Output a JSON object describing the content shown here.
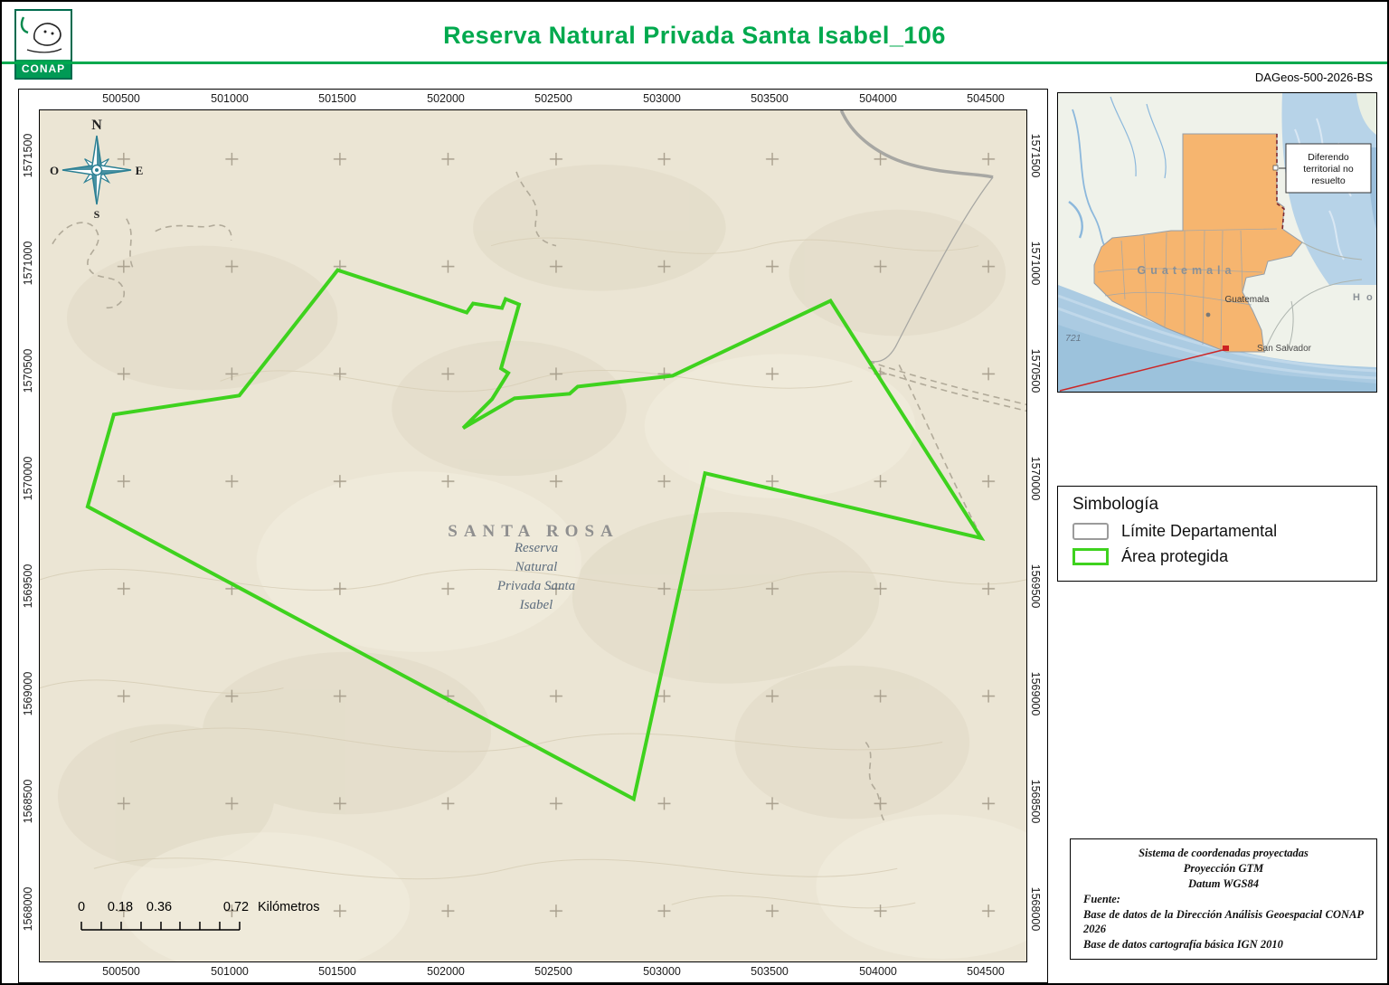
{
  "header": {
    "logo_text": "CONAP",
    "title": "Reserva Natural Privada Santa Isabel_106",
    "doc_code": "DAGeos-500-2026-BS"
  },
  "map": {
    "x_labels": [
      "500500",
      "501000",
      "501500",
      "502000",
      "502500",
      "503000",
      "503500",
      "504000",
      "504500"
    ],
    "y_labels": [
      "1571500",
      "1571000",
      "1570500",
      "1570000",
      "1569500",
      "1569000",
      "1568500",
      "1568000"
    ],
    "compass": {
      "n": "N",
      "e": "E",
      "s": "S",
      "o": "O"
    },
    "department_label": "SANTA ROSA",
    "reserve_lines": [
      "Reserva",
      "Natural",
      "Privada Santa",
      "Isabel"
    ],
    "scale": {
      "l0": "0",
      "l1": "0.18",
      "l2": "0.36",
      "l3": "0.72",
      "unit": "Kilómetros"
    }
  },
  "inset": {
    "country_label": "Guatemala",
    "city_label": "Guatemala",
    "city2_label": "San Salvador",
    "honduras_label": "H o",
    "road_label": "721",
    "note_lines": [
      "Diferendo",
      "territorial no",
      "resuelto"
    ]
  },
  "legend": {
    "title": "Simbología",
    "items": [
      {
        "label": "Límite Departamental"
      },
      {
        "label": "Área protegida"
      }
    ]
  },
  "credits": {
    "line1": "Sistema de coordenadas proyectadas",
    "line2": "Proyección GTM",
    "line3": "Datum WGS84",
    "fuente": "Fuente:",
    "source1": "Base de datos de la Dirección Análisis Geoespacial CONAP 2026",
    "source2": "Base de datos cartografía básica IGN 2010"
  },
  "colors": {
    "accent_green": "#00a94e",
    "protected_area_green": "#3ed21e",
    "guatemala_orange": "#f6b56f",
    "map_background": "#ebe5d4"
  }
}
